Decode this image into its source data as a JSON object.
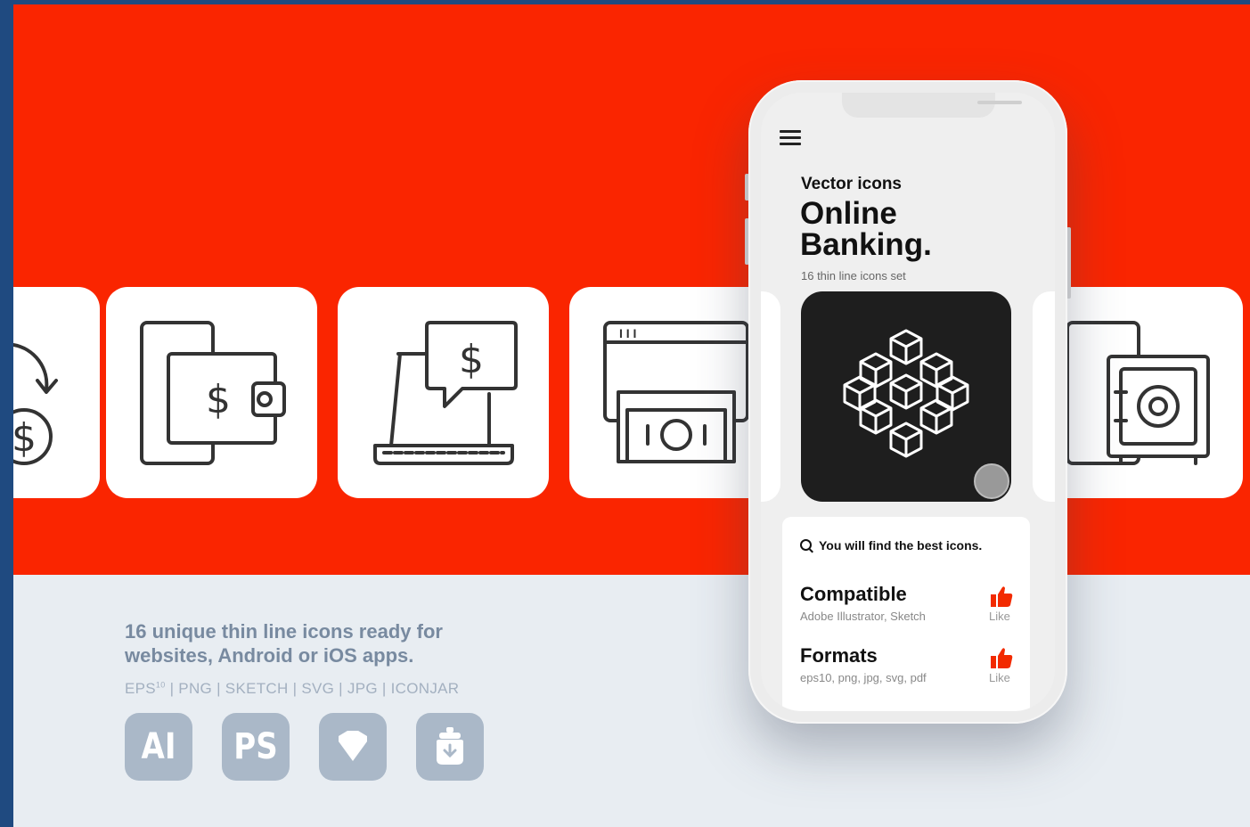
{
  "icons": {
    "card_transfer": "money-transfer-icon",
    "card_wallet": "phone-wallet-icon",
    "card_laptop": "laptop-payment-icon",
    "card_browser": "browser-cash-icon",
    "card_safe": "phone-safe-icon",
    "hero": "blockchain-cubes-icon",
    "menu": "hamburger-menu-icon",
    "search": "search-icon",
    "like": "thumbs-up-icon"
  },
  "glyphs": {
    "dollar": "$",
    "tabs": "I I I"
  },
  "phone": {
    "subtitle": "Vector icons",
    "title_line1": "Online",
    "title_line2": "Banking.",
    "caption": "16 thin line icons set",
    "search_text": "You will find the best icons.",
    "features": [
      {
        "title": "Compatible",
        "description": "Adobe Illustrator, Sketch",
        "like_label": "Like"
      },
      {
        "title": "Formats",
        "description": "eps10, png, jpg, svg, pdf",
        "like_label": "Like"
      }
    ]
  },
  "promo": {
    "tagline_line1": "16 unique thin line icons ready for",
    "tagline_line2": "websites, Android or iOS apps.",
    "formats_prefix": "EPS",
    "formats_super": "10",
    "formats_rest": " | PNG | SKETCH | SVG | JPG | ICONJAR",
    "tools": [
      {
        "label": "AI",
        "icon": "illustrator-icon"
      },
      {
        "label": "PS",
        "icon": "photoshop-icon"
      },
      {
        "label": "",
        "icon": "sketch-diamond-icon"
      },
      {
        "label": "",
        "icon": "iconjar-icon"
      }
    ]
  },
  "colors": {
    "banner": "#fa2500",
    "page_frame": "#1f4a80",
    "background": "#e8edf2",
    "tagline": "#788aa0",
    "tool_badge": "#aab8c8",
    "like": "#f22a00"
  }
}
